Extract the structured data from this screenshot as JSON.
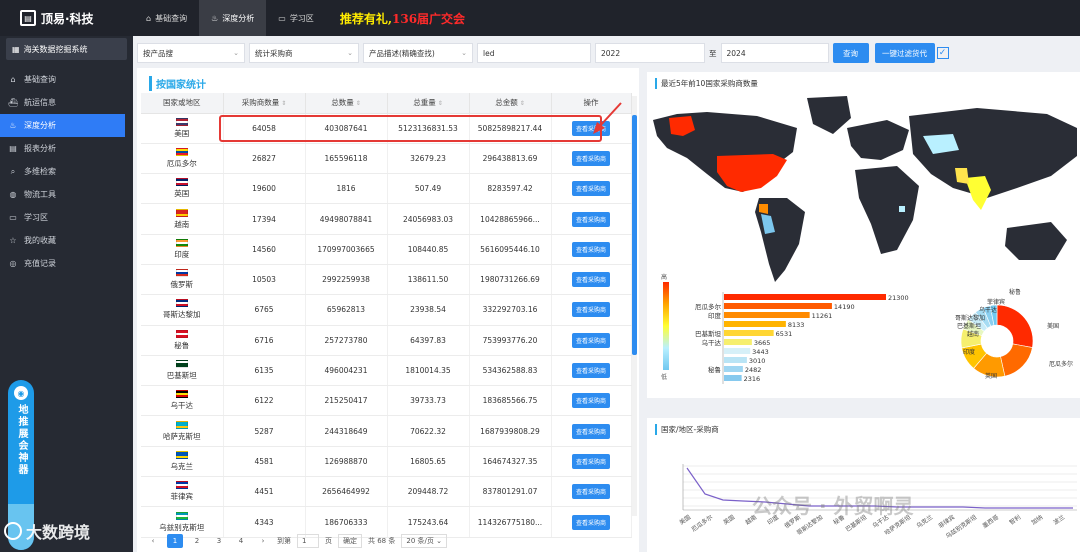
{
  "app": {
    "brand": "顶易·科技",
    "brand_icon": "logo-icon"
  },
  "topnav": {
    "items": [
      {
        "label": "基础查询",
        "icon": "home-icon",
        "active": false
      },
      {
        "label": "深度分析",
        "icon": "analysis-icon",
        "active": true
      },
      {
        "label": "学习区",
        "icon": "learn-icon",
        "active": false
      }
    ],
    "promo_a": "推荐有礼,",
    "promo_b": "136届广交会"
  },
  "sidebar": {
    "header": "海关数据挖掘系统",
    "items": [
      {
        "label": "基础查询",
        "icon": "home-icon"
      },
      {
        "label": "航运信息",
        "icon": "ship-icon"
      },
      {
        "label": "深度分析",
        "icon": "analysis-icon",
        "active": true
      },
      {
        "label": "报表分析",
        "icon": "report-icon"
      },
      {
        "label": "多维检索",
        "icon": "search-icon"
      },
      {
        "label": "物流工具",
        "icon": "globe-icon"
      },
      {
        "label": "学习区",
        "icon": "learn-icon"
      },
      {
        "label": "我的收藏",
        "icon": "star-icon"
      },
      {
        "label": "充值记录",
        "icon": "recharge-icon"
      }
    ],
    "ad_text": "地推展会神器",
    "watermark": "大数跨境"
  },
  "filters": {
    "by_product": "按产品搜",
    "stat_type": "统计采购商",
    "desc_mode": "产品描述(精确查找)",
    "keyword": "led",
    "year_from": "2022",
    "to_label": "至",
    "year_to": "2024",
    "query_button": "查询",
    "filter_button": "一键过滤货代",
    "filter_checked": true
  },
  "table": {
    "title": "按国家统计",
    "headers": [
      "国家或地区",
      "采购商数量",
      "总数量",
      "总重量",
      "总金额",
      "操作"
    ],
    "action_label": "查看采购商",
    "rows": [
      {
        "country": "美国",
        "flag": [
          "#b22234",
          "#ffffff",
          "#3c3b6e"
        ],
        "buyers": "64058",
        "qty": "403087641",
        "weight": "5123136831.53",
        "amount": "50825898217.44"
      },
      {
        "country": "厄瓜多尔",
        "flag": [
          "#ffdd00",
          "#034ea2",
          "#ed1c24"
        ],
        "buyers": "26827",
        "qty": "165596118",
        "weight": "32679.23",
        "amount": "296438813.69"
      },
      {
        "country": "英国",
        "flag": [
          "#012169",
          "#ffffff",
          "#c8102e"
        ],
        "buyers": "19600",
        "qty": "1816",
        "weight": "507.49",
        "amount": "8283597.42"
      },
      {
        "country": "越南",
        "flag": [
          "#da251d",
          "#da251d",
          "#ffcd00"
        ],
        "buyers": "17394",
        "qty": "49498078841",
        "weight": "24056983.03",
        "amount": "10428865966..."
      },
      {
        "country": "印度",
        "flag": [
          "#ff9933",
          "#ffffff",
          "#138808"
        ],
        "buyers": "14560",
        "qty": "170997003665",
        "weight": "108440.85",
        "amount": "5616095446.10"
      },
      {
        "country": "俄罗斯",
        "flag": [
          "#ffffff",
          "#0039a6",
          "#d52b1e"
        ],
        "buyers": "10503",
        "qty": "2992259938",
        "weight": "138611.50",
        "amount": "1980731266.69"
      },
      {
        "country": "哥斯达黎加",
        "flag": [
          "#002b7f",
          "#ffffff",
          "#ce1126"
        ],
        "buyers": "6765",
        "qty": "65962813",
        "weight": "23938.54",
        "amount": "332292703.16"
      },
      {
        "country": "秘鲁",
        "flag": [
          "#d91023",
          "#ffffff",
          "#d91023"
        ],
        "buyers": "6716",
        "qty": "257273780",
        "weight": "64397.83",
        "amount": "753993776.20"
      },
      {
        "country": "巴基斯坦",
        "flag": [
          "#ffffff",
          "#01411c",
          "#01411c"
        ],
        "buyers": "6135",
        "qty": "496004231",
        "weight": "1810014.35",
        "amount": "534362588.83"
      },
      {
        "country": "乌干达",
        "flag": [
          "#000000",
          "#fcdc04",
          "#d90000"
        ],
        "buyers": "6122",
        "qty": "215250417",
        "weight": "39733.73",
        "amount": "183685566.75"
      },
      {
        "country": "哈萨克斯坦",
        "flag": [
          "#00afca",
          "#00afca",
          "#fec50c"
        ],
        "buyers": "5287",
        "qty": "244318649",
        "weight": "70622.32",
        "amount": "1687939808.29"
      },
      {
        "country": "乌克兰",
        "flag": [
          "#0057b7",
          "#0057b7",
          "#ffd700"
        ],
        "buyers": "4581",
        "qty": "126988870",
        "weight": "16805.65",
        "amount": "164674327.35"
      },
      {
        "country": "菲律宾",
        "flag": [
          "#0038a8",
          "#ffffff",
          "#ce1126"
        ],
        "buyers": "4451",
        "qty": "2656464992",
        "weight": "209448.72",
        "amount": "837801291.07"
      },
      {
        "country": "乌兹别克斯坦",
        "flag": [
          "#0099b5",
          "#ffffff",
          "#1eb53a"
        ],
        "buyers": "4343",
        "qty": "186706333",
        "weight": "175243.64",
        "amount": "114326775180..."
      }
    ],
    "pager": {
      "prev": "‹",
      "pages": [
        "1",
        "2",
        "3",
        "4"
      ],
      "next": "›",
      "goto_label": "到第",
      "goto_value": "1",
      "page_unit": "页",
      "confirm": "确定",
      "total": "共 68 条",
      "per_page": "20 条/页"
    }
  },
  "map_panel": {
    "title": "最近5年前10国家采购商数量",
    "legend_high": "高",
    "legend_low": "低",
    "bar_labels": [
      "厄瓜多尔",
      "印度",
      "巴基斯坦",
      "乌干达",
      "秘鲁"
    ],
    "bar_values": [
      21300,
      14190,
      11261,
      8133,
      6531,
      3665,
      3443,
      3010,
      2482,
      2316
    ],
    "pie_labels": [
      "秘鲁",
      "菲律宾",
      "乌干达",
      "哥斯达黎加",
      "巴基斯坦",
      "越南",
      "印度",
      "英国",
      "美国",
      "厄瓜多尔"
    ]
  },
  "line_panel": {
    "title": "国家/地区-采购商",
    "x_labels": [
      "美国",
      "厄瓜多尔",
      "英国",
      "越南",
      "印度",
      "俄罗斯",
      "哥斯达黎加",
      "秘鲁",
      "巴基斯坦",
      "乌干达",
      "哈萨克斯坦",
      "乌克兰",
      "菲律宾",
      "乌兹别克斯坦",
      "墨西哥",
      "智利",
      "加纳",
      "波兰"
    ],
    "watermark": "公众号 · 外贸啊灵"
  },
  "colors": {
    "accent": "#2d8cf0",
    "highlight": "#e53935",
    "usa_fill": "#ff2a00",
    "map_dark": "#2a2d36"
  }
}
